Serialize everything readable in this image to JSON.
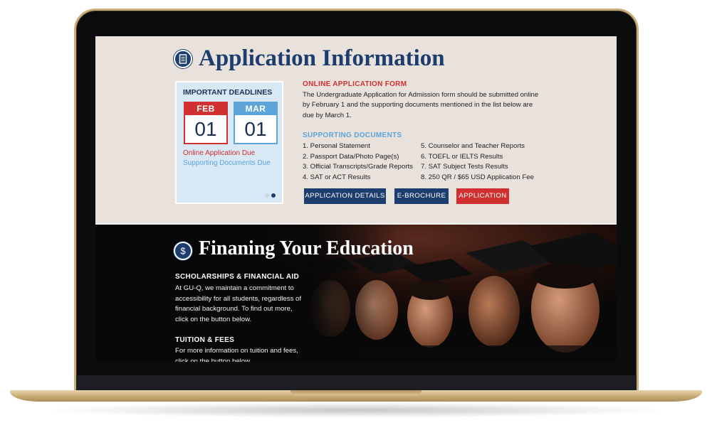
{
  "application": {
    "title": "Application Information",
    "deadlines": {
      "heading": "IMPORTANT DEADLINES",
      "items": [
        {
          "month": "FEB",
          "day": "01",
          "label": "Online Application Due"
        },
        {
          "month": "MAR",
          "day": "01",
          "label": "Supporting Documents Due"
        }
      ]
    },
    "online_form": {
      "heading": "ONLINE APPLICATION FORM",
      "text": "The Undergraduate Application for Admission form should be submitted online by February 1 and the supporting documents mentioned in the list below are due by March 1."
    },
    "supporting": {
      "heading": "SUPPORTING DOCUMENTS",
      "items": [
        "1. Personal Statement",
        "2. Passport Data/Photo Page(s)",
        "3. Official Transcripts/Grade Reports",
        "4. SAT or ACT Results",
        "5. Counselor and Teacher Reports",
        "6. TOEFL or IELTS Results",
        "7. SAT Subject Tests Results",
        "8. 250 QR / $65 USD Application Fee"
      ]
    },
    "buttons": {
      "details": "APPLICATION DETAILS",
      "brochure": "E-BROCHURE",
      "apply": "APPLICATION"
    }
  },
  "finance": {
    "title": "Finaning Your Education",
    "scholarships": {
      "heading": "SCHOLARSHIPS & FINANCIAL AID",
      "text": "At GU-Q, we maintain a commitment to accessibility for all students, regardless of financial background. To find out more, click on the button below."
    },
    "tuition": {
      "heading": "TUITION & FEES",
      "text": "For more information on tuition and fees, click on the button below."
    }
  },
  "colors": {
    "navy": "#1c3d6e",
    "red": "#d0302f",
    "light_blue": "#5da4d9",
    "beige": "#e9e2dc",
    "laptop_gold": "#c9ad78"
  }
}
